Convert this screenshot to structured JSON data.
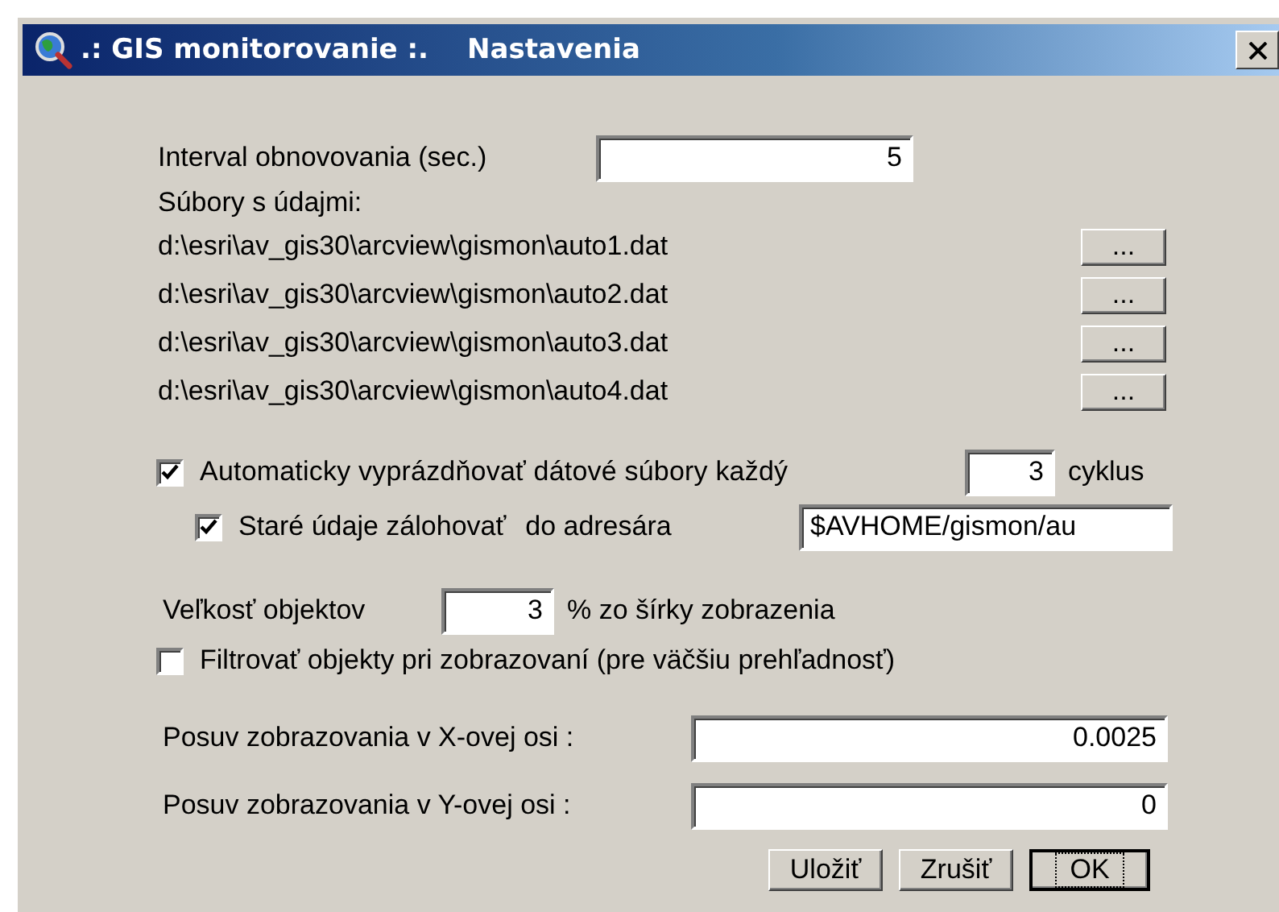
{
  "window": {
    "title": ".: GIS monitorovanie :.",
    "subtitle": "Nastavenia"
  },
  "interval": {
    "label": "Interval obnovovania (sec.)",
    "value": "5"
  },
  "files_label": "Súbory s údajmi:",
  "files": [
    {
      "path": "d:\\esri\\av_gis30\\arcview\\gismon\\auto1.dat",
      "button": "..."
    },
    {
      "path": "d:\\esri\\av_gis30\\arcview\\gismon\\auto2.dat",
      "button": "..."
    },
    {
      "path": "d:\\esri\\av_gis30\\arcview\\gismon\\auto3.dat",
      "button": "..."
    },
    {
      "path": "d:\\esri\\av_gis30\\arcview\\gismon\\auto4.dat",
      "button": "..."
    }
  ],
  "auto_clear": {
    "checked": true,
    "label": "Automaticky vyprázdňovať dátové súbory každý",
    "value": "3",
    "suffix": "cyklus"
  },
  "backup": {
    "checked": true,
    "label": "Staré údaje zálohovať",
    "label_2": "do adresára",
    "value": "$AVHOME/gismon/au"
  },
  "object_size": {
    "label": "Veľkosť objektov",
    "value": "3",
    "suffix": "% zo šírky zobrazenia"
  },
  "filter": {
    "checked": false,
    "label": "Filtrovať objekty pri zobrazovaní (pre väčšiu prehľadnosť)"
  },
  "offsets": [
    {
      "label": "Posuv zobrazovania v X-ovej osi :",
      "value": "0.0025"
    },
    {
      "label": "Posuv zobrazovania v Y-ovej osi :",
      "value": "0"
    }
  ],
  "buttons": [
    {
      "label": "Uložiť",
      "focused": false
    },
    {
      "label": "Zrušiť",
      "focused": false
    },
    {
      "label": "OK",
      "focused": true
    }
  ]
}
